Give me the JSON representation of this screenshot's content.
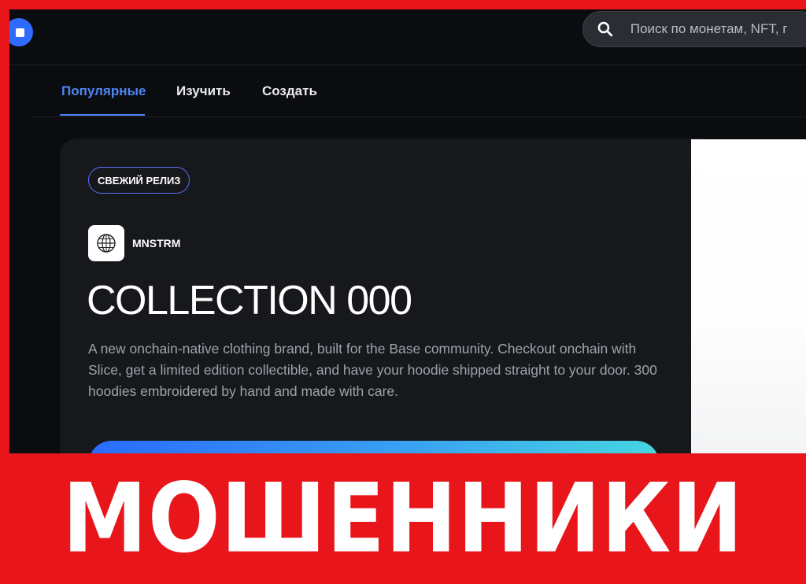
{
  "search": {
    "placeholder": "Поиск по монетам, NFT, г"
  },
  "tabs": [
    {
      "label": "Популярные",
      "active": true
    },
    {
      "label": "Изучить",
      "active": false
    },
    {
      "label": "Создать",
      "active": false
    }
  ],
  "featured": {
    "badge": "СВЕЖИЙ РЕЛИЗ",
    "creator": "MNSTRM",
    "title": "COLLECTION 000",
    "description": "A new onchain-native clothing brand, built for the Base community. Checkout onchain with Slice, get a limited edition collectible, and have your hoodie shipped straight to your door. 300 hoodies embroidered by hand and made with care."
  },
  "banner": {
    "text": "МОШЕННИКИ"
  },
  "colors": {
    "frame": "#e8161b",
    "accent": "#4f86f7",
    "background": "#0b0c0f"
  }
}
